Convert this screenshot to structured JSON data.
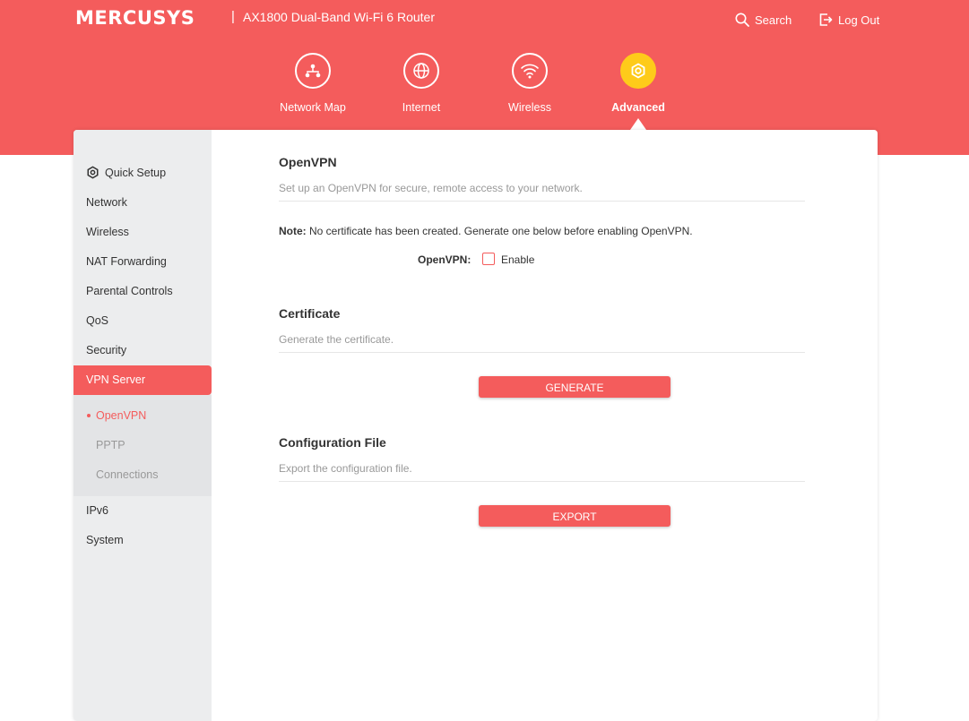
{
  "header": {
    "brand": "MERCUSYS",
    "separator": "|",
    "product": "AX1800 Dual-Band Wi-Fi 6 Router",
    "search_label": "Search",
    "logout_label": "Log Out"
  },
  "nav": {
    "items": [
      {
        "label": "Network Map",
        "icon": "network-map-icon"
      },
      {
        "label": "Internet",
        "icon": "globe-icon"
      },
      {
        "label": "Wireless",
        "icon": "wifi-icon"
      },
      {
        "label": "Advanced",
        "icon": "gear-icon",
        "active": true
      }
    ]
  },
  "sidebar": {
    "items": [
      {
        "label": "Quick Setup",
        "icon": "gear-icon"
      },
      {
        "label": "Network"
      },
      {
        "label": "Wireless"
      },
      {
        "label": "NAT Forwarding"
      },
      {
        "label": "Parental Controls"
      },
      {
        "label": "QoS"
      },
      {
        "label": "Security"
      },
      {
        "label": "VPN Server",
        "active": true
      },
      {
        "label": "IPv6"
      },
      {
        "label": "System"
      }
    ],
    "subitems": [
      {
        "label": "OpenVPN",
        "active": true
      },
      {
        "label": "PPTP"
      },
      {
        "label": "Connections"
      }
    ]
  },
  "openvpn": {
    "title": "OpenVPN",
    "description": "Set up an OpenVPN for secure, remote access to your network.",
    "note_label": "Note:",
    "note_text": " No certificate has been created. Generate one below before enabling OpenVPN.",
    "field_label": "OpenVPN:",
    "enable_label": "Enable",
    "enabled": false
  },
  "certificate": {
    "title": "Certificate",
    "description": "Generate the certificate.",
    "button": "GENERATE"
  },
  "config_file": {
    "title": "Configuration File",
    "description": "Export the configuration file.",
    "button": "EXPORT"
  },
  "colors": {
    "accent": "#f45c5c",
    "active_nav": "#fecb1a",
    "sidebar_bg": "#ecedee"
  }
}
